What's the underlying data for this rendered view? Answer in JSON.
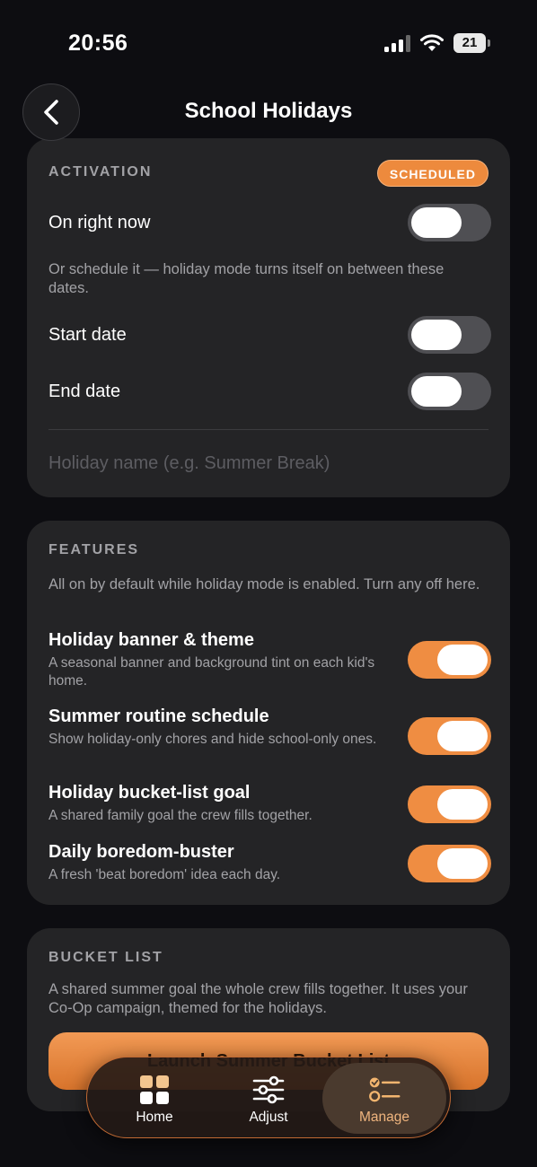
{
  "status_bar": {
    "time": "20:56",
    "battery": "21"
  },
  "header": {
    "title": "School Holidays"
  },
  "activation": {
    "section_title": "ACTIVATION",
    "badge": "SCHEDULED",
    "on_now_label": "On right now",
    "on_now_enabled": false,
    "schedule_hint": "Or schedule it — holiday mode turns itself on between these dates.",
    "start_date_label": "Start date",
    "start_date_enabled": false,
    "end_date_label": "End date",
    "end_date_enabled": false,
    "holiday_name_value": "",
    "holiday_name_placeholder": "Holiday name (e.g. Summer Break)"
  },
  "features": {
    "section_title": "FEATURES",
    "hint": "All on by default while holiday mode is enabled. Turn any off here.",
    "items": [
      {
        "title": "Holiday banner & theme",
        "desc": "A seasonal banner and background tint on each kid's home.",
        "enabled": true
      },
      {
        "title": "Summer routine schedule",
        "desc": "Show holiday-only chores and hide school-only ones.",
        "enabled": true
      },
      {
        "title": "Holiday bucket-list goal",
        "desc": "A shared family goal the crew fills together.",
        "enabled": true
      },
      {
        "title": "Daily boredom-buster",
        "desc": "A fresh 'beat boredom' idea each day.",
        "enabled": true
      }
    ]
  },
  "bucket_list": {
    "section_title": "BUCKET LIST",
    "desc": "A shared summer goal the whole crew fills together. It uses your Co-Op campaign, themed for the holidays.",
    "button_label": "Launch Summer Bucket List"
  },
  "tab_bar": {
    "tabs": [
      {
        "label": "Home",
        "icon": "home-grid-icon"
      },
      {
        "label": "Adjust",
        "icon": "sliders-icon"
      },
      {
        "label": "Manage",
        "icon": "checklist-icon",
        "active": true
      }
    ]
  },
  "colors": {
    "accent": "#ef8d42",
    "card": "#242426",
    "background": "#0d0d11"
  }
}
